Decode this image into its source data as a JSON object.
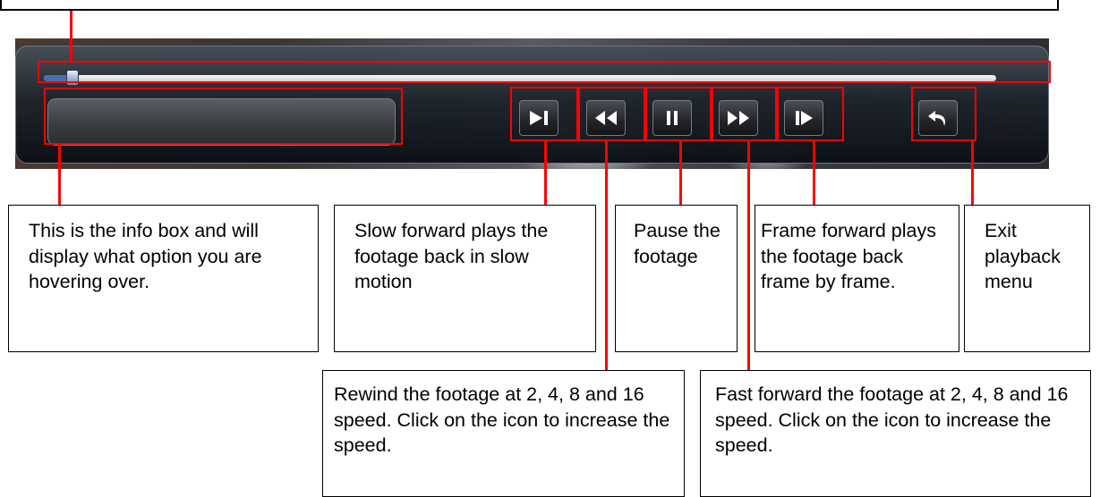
{
  "playback": {
    "progress_fraction": 0.03,
    "info_box_text": "",
    "buttons": [
      {
        "name": "slow-forward-button",
        "icon": "slow-forward-icon"
      },
      {
        "name": "rewind-button",
        "icon": "rewind-icon"
      },
      {
        "name": "pause-button",
        "icon": "pause-icon"
      },
      {
        "name": "fast-forward-button",
        "icon": "fast-forward-icon"
      },
      {
        "name": "frame-forward-button",
        "icon": "frame-forward-icon"
      },
      {
        "name": "exit-button",
        "icon": "return-arrow-icon"
      }
    ]
  },
  "colors": {
    "highlight": "#ff0000",
    "thumb": "#4a6fae"
  },
  "callouts": {
    "info_box": "This is the info box and will display what option you are hovering over.",
    "slow_forward": "Slow forward plays the footage back in slow motion",
    "pause": "Pause the footage",
    "frame_forward": "Frame forward plays the footage back frame by frame.",
    "exit": "Exit playback menu",
    "rewind": "Rewind the footage at 2, 4, 8 and 16 speed. Click on the icon to increase the speed.",
    "fast_forward": "Fast forward the footage at 2, 4, 8 and 16 speed. Click on the icon to increase the speed."
  }
}
